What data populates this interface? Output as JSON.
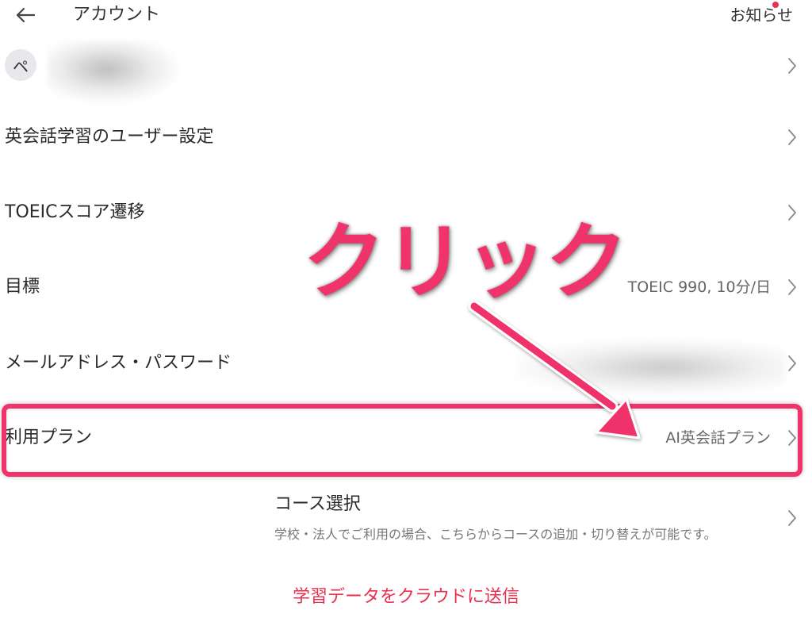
{
  "header": {
    "title": "アカウント",
    "notice_label": "お知らせ",
    "back_icon": "arrow-left-icon",
    "notice_dot_color": "#e8304f"
  },
  "profile": {
    "avatar_initial": "ペ"
  },
  "menu": {
    "items": [
      {
        "label": "英会話学習のユーザー設定",
        "value": ""
      },
      {
        "label": "TOEICスコア遷移",
        "value": ""
      },
      {
        "label": "目標",
        "value": "TOEIC 990, 10分/日"
      },
      {
        "label": "メールアドレス・パスワード",
        "value": ""
      },
      {
        "label": "利用プラン",
        "value": "AI英会話プラン"
      }
    ]
  },
  "course": {
    "title": "コース選択",
    "description": "学校・法人でご利用の場合、こちらからコースの追加・切り替えが可能です。"
  },
  "footer": {
    "cloud_link": "学習データをクラウドに送信"
  },
  "annotation": {
    "text": "クリック",
    "color": "#f0336a"
  },
  "theme": {
    "accent": "#e8304f",
    "highlight": "#f0336a"
  }
}
